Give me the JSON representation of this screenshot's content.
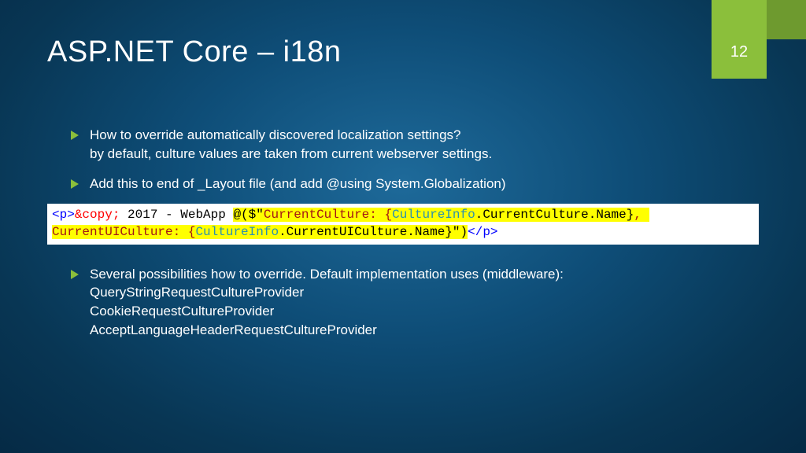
{
  "pageNumber": "12",
  "title": "ASP.NET Core – i18n",
  "bullets": {
    "b1_line1": "How to override automatically discovered localization settings?",
    "b1_line2": "by default, culture values are taken from current webserver settings.",
    "b2": "Add this to end of _Layout file (and add @using System.Globalization)",
    "b3_line1": "Several possibilities how to override. Default implementation uses (middleware):",
    "b3_line2": "QueryStringRequestCultureProvider",
    "b3_line3": "CookieRequestCultureProvider",
    "b3_line4": "AcceptLanguageHeaderRequestCultureProvider"
  },
  "code": {
    "tag_open": "<p>",
    "entity": "&copy;",
    "plain1": " 2017 - WebApp ",
    "at": "@($\"",
    "str1": "CurrentCulture: {",
    "ci": "CultureInfo",
    "mem1": ".CurrentCulture.Name",
    "brace1": "}",
    "comma": ", ",
    "str2": "CurrentUICulture: {",
    "mem2": ".CurrentUICulture.Name",
    "brace2": "}",
    "endq": "\")",
    "tag_close": "</p>"
  }
}
